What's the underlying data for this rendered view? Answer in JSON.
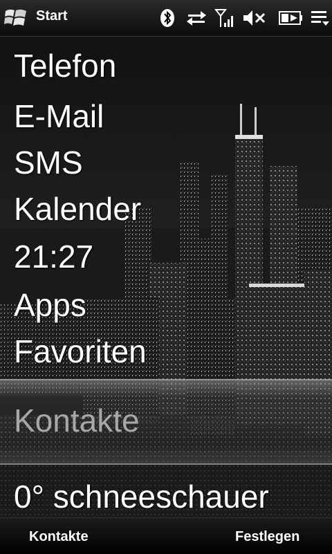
{
  "statusbar": {
    "title": "Start",
    "icons": [
      "windows-logo-icon",
      "bluetooth-icon",
      "data-sync-icon",
      "signal-strength-icon",
      "speaker-muted-icon",
      "battery-icon",
      "menu-dropdown-icon"
    ]
  },
  "menu": {
    "items": [
      {
        "label": "Telefon"
      },
      {
        "label": "E-Mail"
      },
      {
        "label": "SMS"
      },
      {
        "label": "Kalender"
      },
      {
        "label": "21:27"
      },
      {
        "label": "Apps"
      },
      {
        "label": "Favoriten"
      },
      {
        "label": "Kontakte",
        "selected": true
      },
      {
        "label": "0° schneeschauer"
      }
    ]
  },
  "softkeys": {
    "left": "Kontakte",
    "right": "Festlegen"
  },
  "colors": {
    "accent_text": "#ffffff",
    "selected_text": "#a8a8a8",
    "bar_bg": "#111111"
  }
}
